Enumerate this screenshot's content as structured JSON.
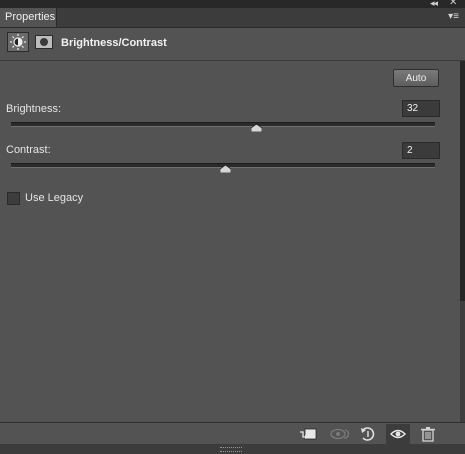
{
  "window": {
    "collapse_glyph": "◂◂",
    "close_glyph": "✕"
  },
  "tab": {
    "label": "Properties"
  },
  "panel_menu_glyph": "▾≡",
  "header": {
    "title": "Brightness/Contrast",
    "adjustment_icon": "brightness-sun-icon",
    "mask_icon": "layer-mask-icon"
  },
  "controls": {
    "auto_label": "Auto",
    "brightness": {
      "label": "Brightness:",
      "value": "32",
      "fraction": 0.58
    },
    "contrast": {
      "label": "Contrast:",
      "value": "2",
      "fraction": 0.505
    },
    "use_legacy": {
      "label": "Use Legacy",
      "checked": false
    }
  },
  "footer_icons": [
    "clip-to-layer-icon",
    "view-previous-state-icon",
    "reset-icon",
    "visibility-eye-icon",
    "trash-icon"
  ]
}
